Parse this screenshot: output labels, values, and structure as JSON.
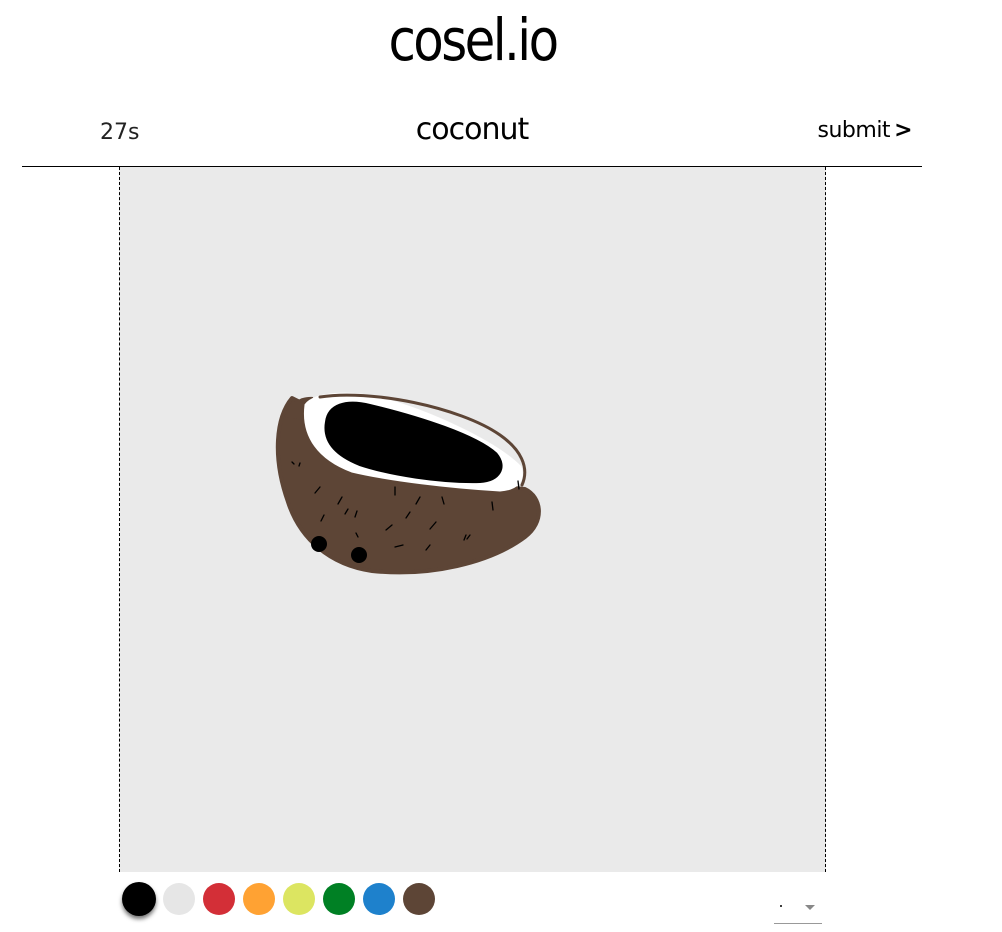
{
  "header": {
    "logo_text": "cosel.io"
  },
  "topbar": {
    "timer": "27s",
    "prompt_word": "coconut",
    "submit_label": "submit",
    "submit_arrow": ">"
  },
  "palette": {
    "colors": [
      "#000000",
      "#e6e6e6",
      "#d32f37",
      "#ffa233",
      "#dce561",
      "#008024",
      "#1e81cc",
      "#5d4536"
    ],
    "selected_index": 0
  },
  "brush": {
    "selected": "small"
  }
}
